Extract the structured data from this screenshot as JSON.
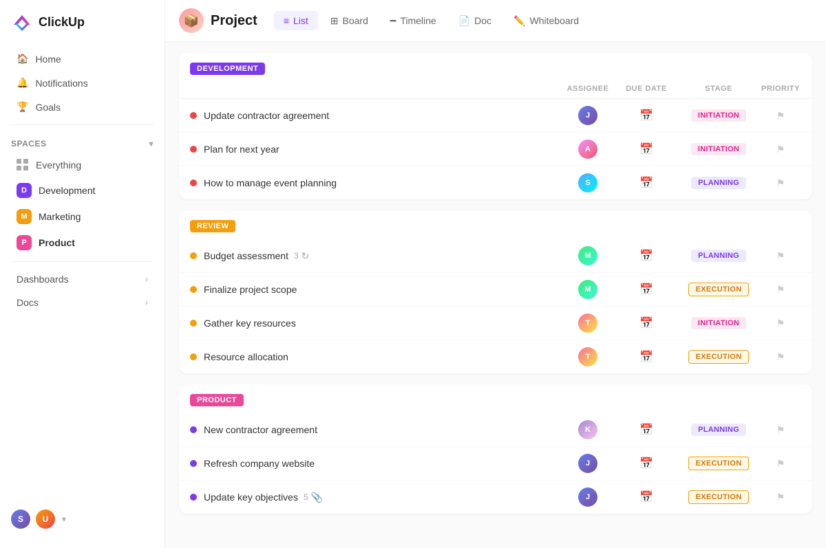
{
  "app": {
    "name": "ClickUp"
  },
  "sidebar": {
    "nav": [
      {
        "id": "home",
        "label": "Home",
        "icon": "🏠"
      },
      {
        "id": "notifications",
        "label": "Notifications",
        "icon": "🔔"
      },
      {
        "id": "goals",
        "label": "Goals",
        "icon": "🏆"
      }
    ],
    "spaces_label": "Spaces",
    "spaces": [
      {
        "id": "everything",
        "label": "Everything",
        "color": null,
        "letter": null,
        "bold": false
      },
      {
        "id": "development",
        "label": "Development",
        "color": "#7c3aed",
        "letter": "D",
        "bold": false
      },
      {
        "id": "marketing",
        "label": "Marketing",
        "color": "#f59e0b",
        "letter": "M",
        "bold": false
      },
      {
        "id": "product",
        "label": "Product",
        "color": "#ec4899",
        "letter": "P",
        "bold": true
      }
    ],
    "bottom_nav": [
      {
        "id": "dashboards",
        "label": "Dashboards"
      },
      {
        "id": "docs",
        "label": "Docs"
      }
    ]
  },
  "header": {
    "project_title": "Project",
    "tabs": [
      {
        "id": "list",
        "label": "List",
        "active": true,
        "icon": "≡"
      },
      {
        "id": "board",
        "label": "Board",
        "active": false,
        "icon": "⊞"
      },
      {
        "id": "timeline",
        "label": "Timeline",
        "active": false,
        "icon": "━"
      },
      {
        "id": "doc",
        "label": "Doc",
        "active": false,
        "icon": "📄"
      },
      {
        "id": "whiteboard",
        "label": "Whiteboard",
        "active": false,
        "icon": "✏️"
      }
    ]
  },
  "columns": {
    "assignee": "ASSIGNEE",
    "due_date": "DUE DATE",
    "stage": "STAGE",
    "priority": "PRIORITY"
  },
  "sections": [
    {
      "id": "development",
      "label": "DEVELOPMENT",
      "badge_color": "#7c3aed",
      "tasks": [
        {
          "name": "Update contractor agreement",
          "dot_color": "#ef4444",
          "stage": "INITIATION",
          "stage_class": "stage-initiation",
          "av_class": "av1",
          "av_letter": "J"
        },
        {
          "name": "Plan for next year",
          "dot_color": "#ef4444",
          "stage": "INITIATION",
          "stage_class": "stage-initiation",
          "av_class": "av2",
          "av_letter": "A"
        },
        {
          "name": "How to manage event planning",
          "dot_color": "#ef4444",
          "stage": "PLANNING",
          "stage_class": "stage-planning",
          "av_class": "av3",
          "av_letter": "S"
        }
      ]
    },
    {
      "id": "review",
      "label": "REVIEW",
      "badge_color": "#f59e0b",
      "tasks": [
        {
          "name": "Budget assessment",
          "dot_color": "#f59e0b",
          "stage": "PLANNING",
          "stage_class": "stage-planning",
          "av_class": "av4",
          "av_letter": "M",
          "count": 3
        },
        {
          "name": "Finalize project scope",
          "dot_color": "#f59e0b",
          "stage": "EXECUTION",
          "stage_class": "stage-execution",
          "av_class": "av4",
          "av_letter": "M"
        },
        {
          "name": "Gather key resources",
          "dot_color": "#f59e0b",
          "stage": "INITIATION",
          "stage_class": "stage-initiation",
          "av_class": "av5",
          "av_letter": "T"
        },
        {
          "name": "Resource allocation",
          "dot_color": "#f59e0b",
          "stage": "EXECUTION",
          "stage_class": "stage-execution",
          "av_class": "av5",
          "av_letter": "T"
        }
      ]
    },
    {
      "id": "product",
      "label": "PRODUCT",
      "badge_color": "#ec4899",
      "tasks": [
        {
          "name": "New contractor agreement",
          "dot_color": "#7c3aed",
          "stage": "PLANNING",
          "stage_class": "stage-planning",
          "av_class": "av6",
          "av_letter": "K"
        },
        {
          "name": "Refresh company website",
          "dot_color": "#7c3aed",
          "stage": "EXECUTION",
          "stage_class": "stage-execution",
          "av_class": "av1",
          "av_letter": "J"
        },
        {
          "name": "Update key objectives",
          "dot_color": "#7c3aed",
          "stage": "EXECUTION",
          "stage_class": "stage-execution",
          "av_class": "av1",
          "av_letter": "J",
          "count": 5,
          "has_attachment": true
        }
      ]
    }
  ]
}
